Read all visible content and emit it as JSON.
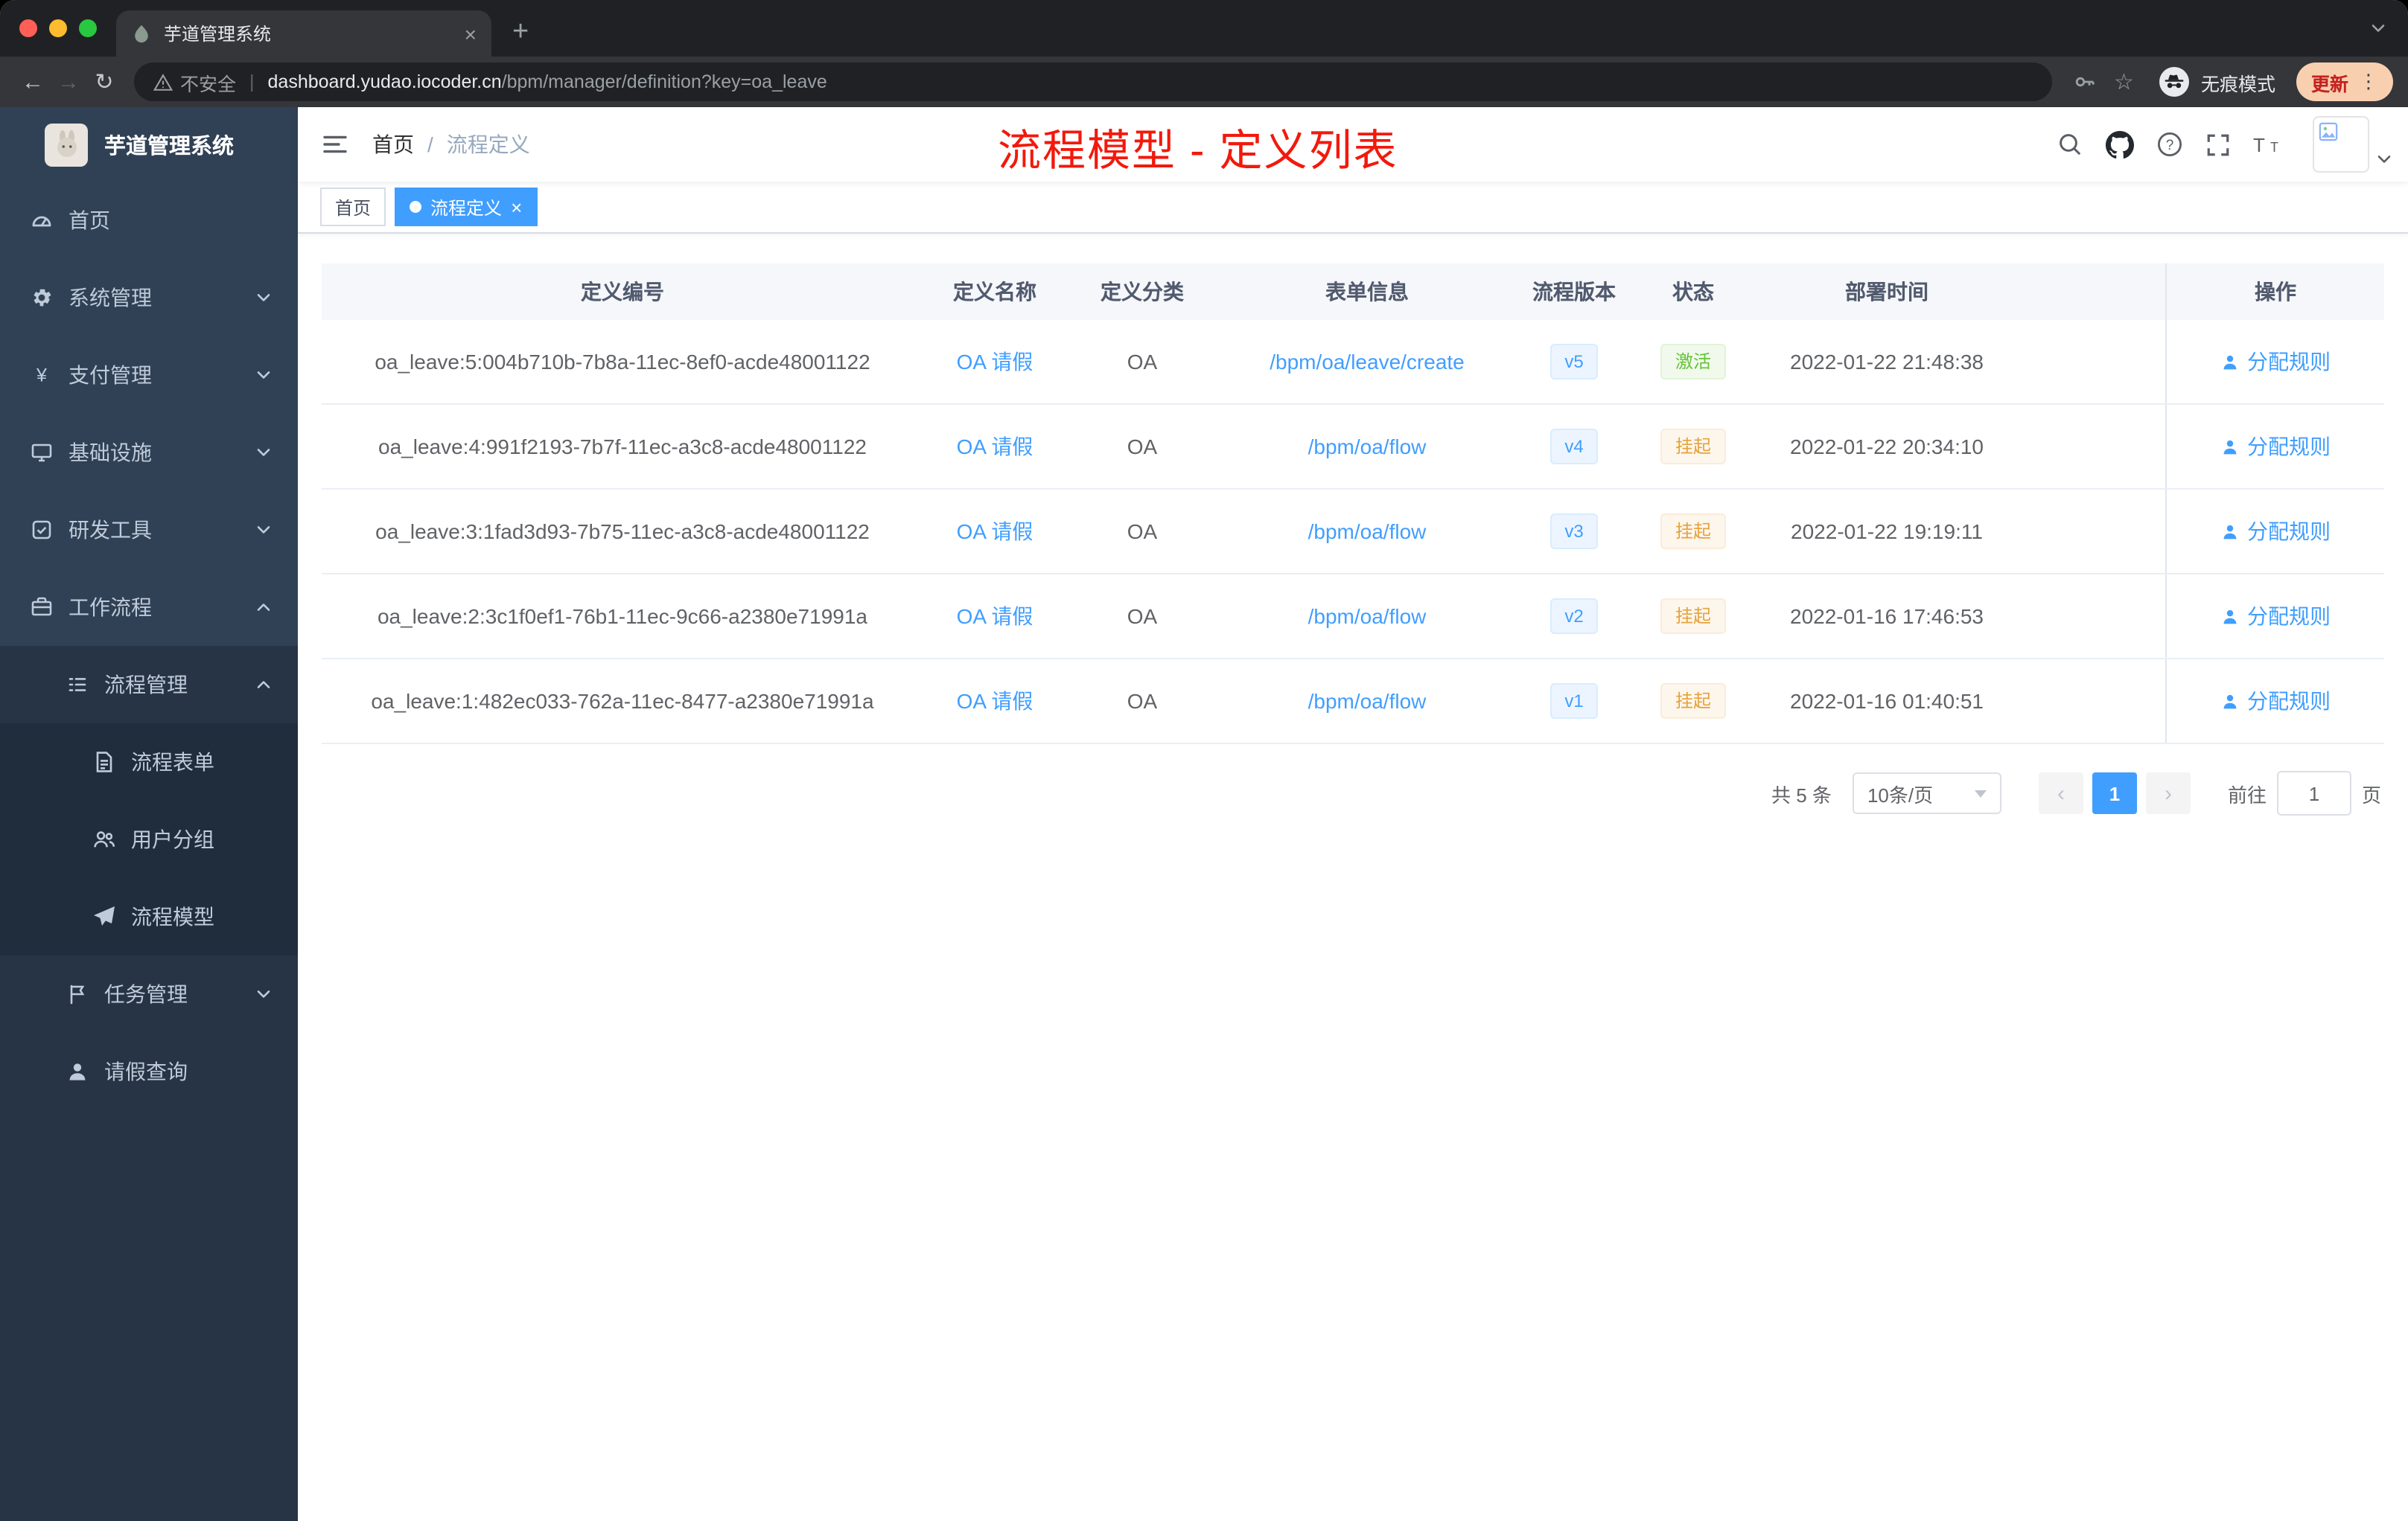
{
  "colors": {
    "accent": "#409eff",
    "annotation": "#f2190c",
    "success": "#67c23a",
    "warning": "#e6a23c",
    "sidebar_bg": "#304156"
  },
  "browser": {
    "tab_title": "芋道管理系统",
    "security_label": "不安全",
    "url_host": "dashboard.yudao.iocoder.cn",
    "url_path": "/bpm/manager/definition?key=oa_leave",
    "incognito_label": "无痕模式",
    "update_label": "更新"
  },
  "sidebar": {
    "logo_title": "芋道管理系统",
    "items": [
      {
        "label": "首页",
        "icon": "dashboard",
        "level": 1
      },
      {
        "label": "系统管理",
        "icon": "gear",
        "level": 1,
        "chevron": "down"
      },
      {
        "label": "支付管理",
        "icon": "yen",
        "level": 1,
        "chevron": "down"
      },
      {
        "label": "基础设施",
        "icon": "infra",
        "level": 1,
        "chevron": "down"
      },
      {
        "label": "研发工具",
        "icon": "tool",
        "level": 1,
        "chevron": "down"
      },
      {
        "label": "工作流程",
        "icon": "workflow",
        "level": 1,
        "chevron": "up"
      },
      {
        "label": "流程管理",
        "icon": "list",
        "level": 2,
        "chevron": "up"
      },
      {
        "label": "流程表单",
        "icon": "form",
        "level": 3
      },
      {
        "label": "用户分组",
        "icon": "group",
        "level": 3
      },
      {
        "label": "流程模型",
        "icon": "plane",
        "level": 3
      },
      {
        "label": "任务管理",
        "icon": "task",
        "level": 2,
        "chevron": "down"
      },
      {
        "label": "请假查询",
        "icon": "user",
        "level": 2
      }
    ]
  },
  "navbar": {
    "breadcrumb": [
      "首页",
      "流程定义"
    ],
    "breadcrumb_separator": "/",
    "annotation": "流程模型 - 定义列表"
  },
  "tags": [
    {
      "label": "首页",
      "active": false,
      "closable": false
    },
    {
      "label": "流程定义",
      "active": true,
      "closable": true
    }
  ],
  "table": {
    "columns": [
      "定义编号",
      "定义名称",
      "定义分类",
      "表单信息",
      "流程版本",
      "状态",
      "部署时间",
      "操作"
    ],
    "rows": [
      {
        "id": "oa_leave:5:004b710b-7b8a-11ec-8ef0-acde48001122",
        "name": "OA 请假",
        "category": "OA",
        "form": "/bpm/oa/leave/create",
        "version": "v5",
        "status": "激活",
        "status_type": "success",
        "time": "2022-01-22 21:48:38",
        "action": "分配规则"
      },
      {
        "id": "oa_leave:4:991f2193-7b7f-11ec-a3c8-acde48001122",
        "name": "OA 请假",
        "category": "OA",
        "form": "/bpm/oa/flow",
        "version": "v4",
        "status": "挂起",
        "status_type": "warning",
        "time": "2022-01-22 20:34:10",
        "action": "分配规则"
      },
      {
        "id": "oa_leave:3:1fad3d93-7b75-11ec-a3c8-acde48001122",
        "name": "OA 请假",
        "category": "OA",
        "form": "/bpm/oa/flow",
        "version": "v3",
        "status": "挂起",
        "status_type": "warning",
        "time": "2022-01-22 19:19:11",
        "action": "分配规则"
      },
      {
        "id": "oa_leave:2:3c1f0ef1-76b1-11ec-9c66-a2380e71991a",
        "name": "OA 请假",
        "category": "OA",
        "form": "/bpm/oa/flow",
        "version": "v2",
        "status": "挂起",
        "status_type": "warning",
        "time": "2022-01-16 17:46:53",
        "action": "分配规则"
      },
      {
        "id": "oa_leave:1:482ec033-762a-11ec-8477-a2380e71991a",
        "name": "OA 请假",
        "category": "OA",
        "form": "/bpm/oa/flow",
        "version": "v1",
        "status": "挂起",
        "status_type": "warning",
        "time": "2022-01-16 01:40:51",
        "action": "分配规则"
      }
    ]
  },
  "pagination": {
    "total": "共 5 条",
    "size": "10条/页",
    "page": "1",
    "goto_label": "前往",
    "goto_value": "1",
    "page_unit": "页"
  }
}
